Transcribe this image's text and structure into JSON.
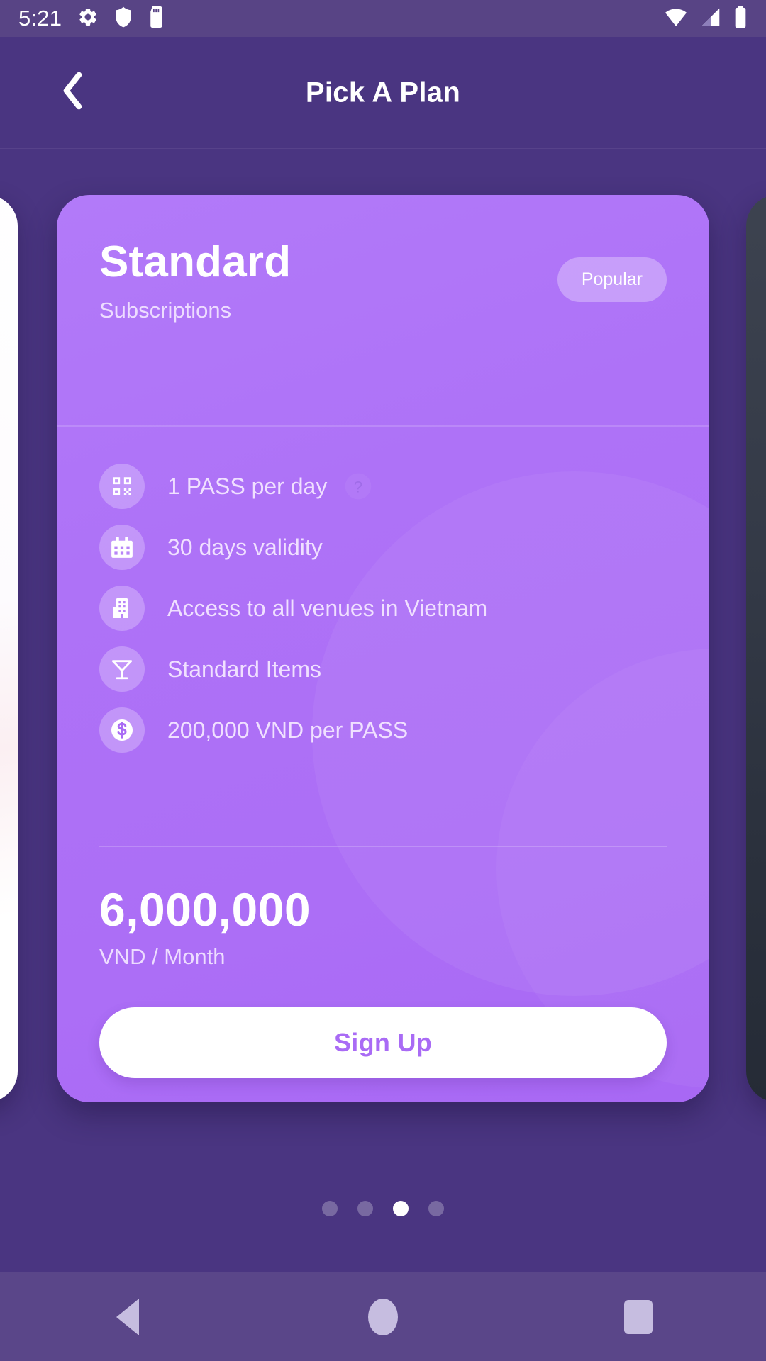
{
  "status_bar": {
    "time": "5:21",
    "left_icons": [
      "gear-icon",
      "shield-icon",
      "sd-card-icon"
    ],
    "right_icons": [
      "wifi-icon",
      "cellular-signal-icon",
      "battery-icon"
    ]
  },
  "header": {
    "title": "Pick A Plan",
    "back_icon": "chevron-left-icon"
  },
  "plan": {
    "name": "Standard",
    "subtitle": "Subscriptions",
    "badge": "Popular",
    "features": [
      {
        "icon": "qr-code-icon",
        "label": "1 PASS per day",
        "help": "?"
      },
      {
        "icon": "calendar-icon",
        "label": "30 days validity",
        "help": ""
      },
      {
        "icon": "building-icon",
        "label": "Access to all venues in Vietnam",
        "help": ""
      },
      {
        "icon": "cocktail-icon",
        "label": "Standard Items",
        "help": ""
      },
      {
        "icon": "dollar-coin-icon",
        "label": "200,000 VND per PASS",
        "help": ""
      }
    ],
    "price_amount": "6,000,000",
    "price_period": "VND / Month",
    "cta_label": "Sign Up"
  },
  "carousel": {
    "total_pages": 4,
    "active_page": 3
  },
  "nav_bar": {
    "buttons": [
      "back-triangle-icon",
      "home-circle-icon",
      "recents-square-icon"
    ]
  },
  "colors": {
    "background": "#4a3581",
    "header": "#4a3581",
    "status_bar": "#584485",
    "card_purple": "#ae72f7",
    "card_text": "#ffffff",
    "card_subtext": "#eddcff",
    "cta_background": "#ffffff",
    "cta_text": "#a96bf5",
    "nav_bar": "#5a4689",
    "nav_icon": "#c6bde0"
  }
}
